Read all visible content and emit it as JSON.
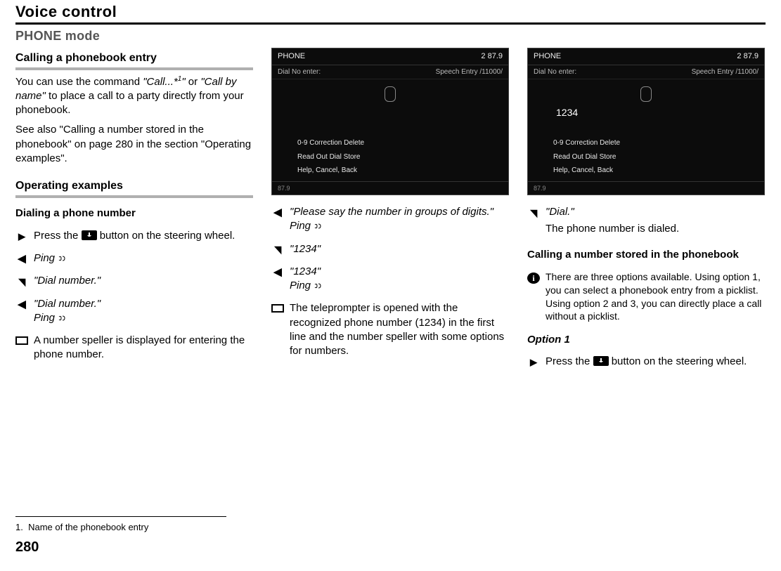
{
  "header": {
    "title": "Voice control",
    "mode": "PHONE mode"
  },
  "col1": {
    "sec1_title": "Calling a phonebook entry",
    "p1_a": "You can use the command ",
    "p1_b": "\"Call...*",
    "p1_sup": "1",
    "p1_c": "\"",
    "p1_d": " or ",
    "p1_e": "\"Call by name\"",
    "p1_f": " to place a call to a party directly from your phonebook.",
    "p2": "See also \"Calling a number stored in the phonebook\" on page 280 in the section \"Operating examples\".",
    "sec2_title": "Operating examples",
    "sub1": "Dialing a phone number",
    "s1_press_a": "Press the ",
    "s1_press_b": " button on the steering wheel.",
    "s2_ping": "Ping",
    "s3_dial": "\"Dial number.\"",
    "s4_dial": "\"Dial number.\"",
    "s4_ping": "Ping",
    "s5_speller": "A number speller is displayed for entering the phone number."
  },
  "col2": {
    "ss": {
      "top_left": "PHONE",
      "top_right": "2   87.9",
      "sub_left": "Dial No enter:",
      "sub_right": "Speech Entry  /11000/",
      "l1": "0-9   Correction   Delete",
      "l2": "Read Out   Dial   Store",
      "l3": "Help, Cancel, Back",
      "foot": "87.9"
    },
    "s1a": "\"Please say the number in groups of digits.\"",
    "s1b": "Ping",
    "s2": "\"1234\"",
    "s3a": "\"1234\"",
    "s3b": "Ping",
    "s4": "The teleprompter is opened with the recognized phone number (1234) in the first line and the number speller with some options for numbers."
  },
  "col3": {
    "ss": {
      "top_left": "PHONE",
      "top_right": "2   87.9",
      "sub_left": "Dial No enter:",
      "sub_right": "Speech Entry  /11000/",
      "num": "1234",
      "l1": "0-9   Correction   Delete",
      "l2": "Read Out   Dial   Store",
      "l3": "Help, Cancel, Back",
      "foot": "87.9"
    },
    "s1": "\"Dial.\"",
    "s1b": "The phone number is dialed.",
    "sub": "Calling a number stored in the phonebook",
    "info": "There are three options available. Using option 1, you can select a phonebook entry from a picklist. Using option 2 and 3, you can directly place a call without a picklist.",
    "opt1": "Option 1",
    "press_a": "Press the ",
    "press_b": " button on the steering wheel."
  },
  "footnote": {
    "num": "1.",
    "text": "Name of the phonebook entry"
  },
  "pagenum": "280"
}
